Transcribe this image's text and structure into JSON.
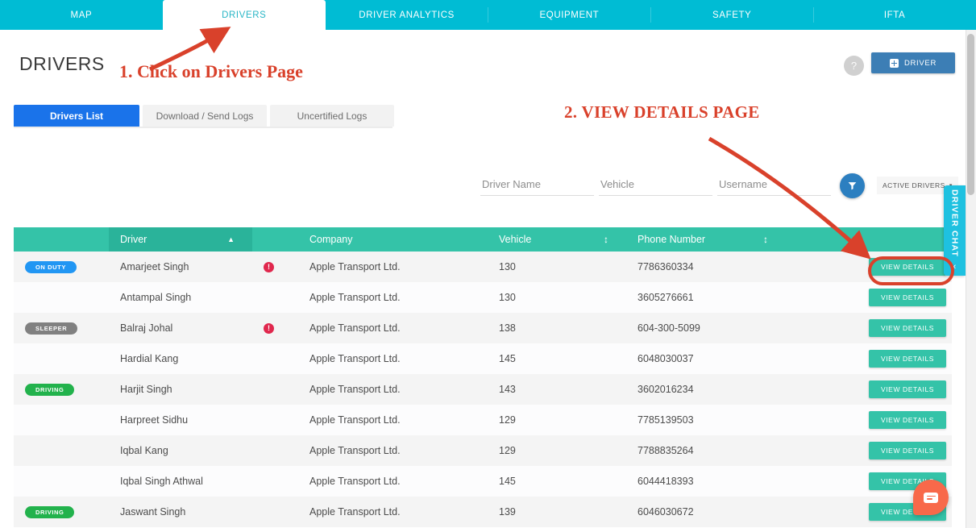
{
  "topnav": {
    "tabs": [
      {
        "label": "MAP",
        "active": false
      },
      {
        "label": "DRIVERS",
        "active": true
      },
      {
        "label": "DRIVER ANALYTICS",
        "active": false
      },
      {
        "label": "EQUIPMENT",
        "active": false
      },
      {
        "label": "SAFETY",
        "active": false
      },
      {
        "label": "IFTA",
        "active": false
      }
    ],
    "accent_color": "#00bcd4",
    "active_text_color": "#29b6c6"
  },
  "header": {
    "title": "DRIVERS",
    "help_label": "?",
    "add_driver_label": "DRIVER",
    "add_driver_color": "#3c7eb5"
  },
  "subtabs": [
    {
      "label": "Drivers List",
      "active": true
    },
    {
      "label": "Download / Send Logs",
      "active": false
    },
    {
      "label": "Uncertified Logs",
      "active": false
    }
  ],
  "filters": {
    "driver_name": {
      "value": "",
      "placeholder": "Driver Name"
    },
    "vehicle": {
      "value": "",
      "placeholder": "Vehicle"
    },
    "username": {
      "value": "",
      "placeholder": "Username"
    },
    "filter_button_icon": "funnel-icon",
    "status_select": {
      "value": "ACTIVE DRIVERS",
      "caret": "▾"
    }
  },
  "table": {
    "header_color": "#34c3a8",
    "columns": [
      {
        "key": "status",
        "label": "",
        "sort": "none"
      },
      {
        "key": "driver",
        "label": "Driver",
        "sort": "asc"
      },
      {
        "key": "alert",
        "label": "",
        "sort": "none"
      },
      {
        "key": "company",
        "label": "Company",
        "sort": "none"
      },
      {
        "key": "vehicle",
        "label": "Vehicle",
        "sort": "both"
      },
      {
        "key": "phone",
        "label": "Phone Number",
        "sort": "both"
      },
      {
        "key": "action",
        "label": "",
        "sort": "none"
      }
    ],
    "sort_asc_glyph": "▲",
    "sort_both_glyph": "↕",
    "action_label": "VIEW DETAILS",
    "rows": [
      {
        "status": "ON DUTY",
        "status_kind": "onduty",
        "driver": "Amarjeet Singh",
        "alert": true,
        "company": "Apple Transport Ltd.",
        "vehicle": "130",
        "phone": "7786360334"
      },
      {
        "status": "",
        "status_kind": "",
        "driver": "Antampal Singh",
        "alert": false,
        "company": "Apple Transport Ltd.",
        "vehicle": "130",
        "phone": "3605276661"
      },
      {
        "status": "SLEEPER",
        "status_kind": "sleeper",
        "driver": "Balraj Johal",
        "alert": true,
        "company": "Apple Transport Ltd.",
        "vehicle": "138",
        "phone": "604-300-5099"
      },
      {
        "status": "",
        "status_kind": "",
        "driver": "Hardial Kang",
        "alert": false,
        "company": "Apple Transport Ltd.",
        "vehicle": "145",
        "phone": "6048030037"
      },
      {
        "status": "DRIVING",
        "status_kind": "driving",
        "driver": "Harjit Singh",
        "alert": false,
        "company": "Apple Transport Ltd.",
        "vehicle": "143",
        "phone": "3602016234"
      },
      {
        "status": "",
        "status_kind": "",
        "driver": "Harpreet Sidhu",
        "alert": false,
        "company": "Apple Transport Ltd.",
        "vehicle": "129",
        "phone": "7785139503"
      },
      {
        "status": "",
        "status_kind": "",
        "driver": "Iqbal Kang",
        "alert": false,
        "company": "Apple Transport Ltd.",
        "vehicle": "129",
        "phone": "7788835264"
      },
      {
        "status": "",
        "status_kind": "",
        "driver": "Iqbal Singh Athwal",
        "alert": false,
        "company": "Apple Transport Ltd.",
        "vehicle": "145",
        "phone": "6044418393"
      },
      {
        "status": "DRIVING",
        "status_kind": "driving",
        "driver": "Jaswant Singh",
        "alert": false,
        "company": "Apple Transport Ltd.",
        "vehicle": "139",
        "phone": "6046030672"
      }
    ]
  },
  "chat_tab": {
    "label": "DRIVER CHAT",
    "chevron": "‹",
    "color": "#1ec1e0"
  },
  "fab": {
    "icon": "chat-bubble-icon",
    "color": "#f8694a"
  },
  "annotations": [
    {
      "id": "anno-1",
      "text": "1. Click on Drivers Page",
      "color": "#d9412b"
    },
    {
      "id": "anno-2",
      "text": "2. VIEW DETAILS PAGE",
      "color": "#d9412b"
    }
  ]
}
